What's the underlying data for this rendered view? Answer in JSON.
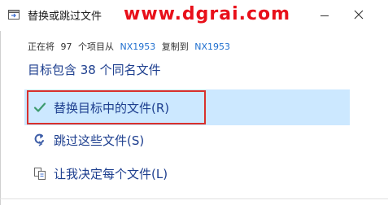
{
  "window": {
    "title": "替换或跳过文件",
    "watermark": "www.dgrai.com",
    "minimize_icon": "minimize-icon",
    "close_icon": "close-icon"
  },
  "status": {
    "prefix": "正在将",
    "count": "97",
    "middle": "个项目从",
    "source": "NX1953",
    "copy_to": "复制到",
    "destination": "NX1953"
  },
  "headline": "目标包含 38 个同名文件",
  "options": [
    {
      "label": "替换目标中的文件(R)",
      "icon": "checkmark-icon",
      "selected": true
    },
    {
      "label": "跳过这些文件(S)",
      "icon": "skip-arrow-icon",
      "selected": false
    },
    {
      "label": "让我决定每个文件(L)",
      "icon": "compare-files-icon",
      "selected": false
    }
  ],
  "colors": {
    "accent_text": "#1e3f8f",
    "link": "#1f6fcf",
    "selected_bg": "#cce8ff",
    "highlight_border": "#d9302c",
    "watermark": "#e8101a",
    "check": "#3c9a6e"
  }
}
